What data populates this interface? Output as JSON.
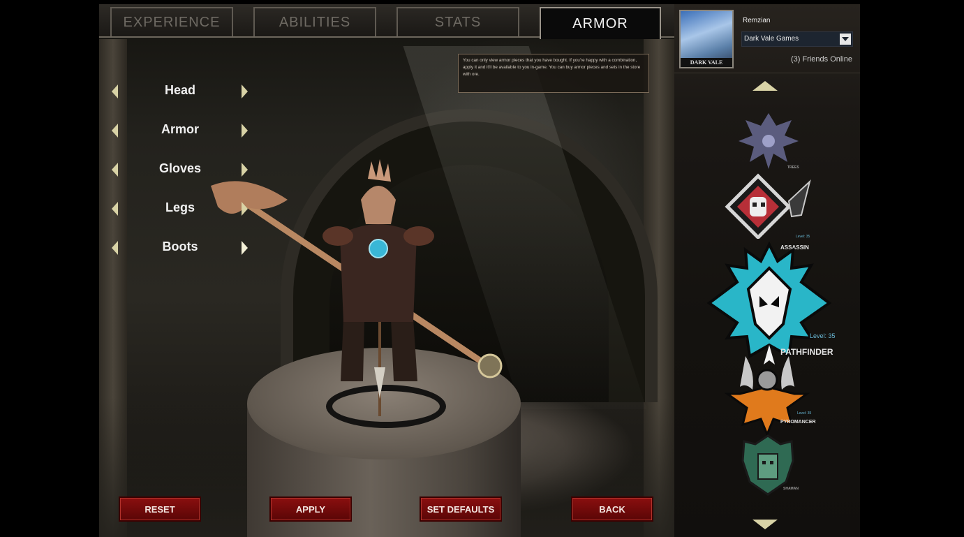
{
  "tabs": [
    {
      "label": "EXPERIENCE",
      "active": false
    },
    {
      "label": "ABILITIES",
      "active": false
    },
    {
      "label": "STATS",
      "active": false
    },
    {
      "label": "ARMOR",
      "active": true
    }
  ],
  "armor_slots": [
    {
      "label": "Head"
    },
    {
      "label": "Armor"
    },
    {
      "label": "Gloves"
    },
    {
      "label": "Legs"
    },
    {
      "label": "Boots"
    }
  ],
  "info_text": "You can only view armor pieces that you have bought. If you're happy with a combination, apply it and it'll be available to you in-game. You can buy armor pieces and sets in the store with ore.",
  "buttons": {
    "reset": "RESET",
    "apply": "APPLY",
    "set_defaults": "SET DEFAULTS",
    "back": "BACK"
  },
  "profile": {
    "username": "Remzian",
    "company": "Dark Vale Games",
    "avatar_caption": "DARK VALE",
    "friends_online": "(3) Friends Online"
  },
  "classes": [
    {
      "name": "TREES",
      "level": "",
      "color": "#7a7ca8",
      "selected": false
    },
    {
      "name": "ASSASSIN",
      "level": "Level: 35",
      "color": "#c0303a",
      "selected": false
    },
    {
      "name": "PATHFINDER",
      "level": "Level: 35",
      "color": "#29b6c8",
      "selected": true
    },
    {
      "name": "PYROMANCER",
      "level": "Level: 35",
      "color": "#e07a1c",
      "selected": false
    },
    {
      "name": "SHAMAN",
      "level": "",
      "color": "#3b8a68",
      "selected": false
    }
  ],
  "icons": {
    "slot_prev": "chevron-left-icon",
    "slot_next": "chevron-right-icon",
    "scroll_up": "triangle-up-icon",
    "scroll_down": "triangle-down-icon",
    "dropdown": "chevron-down-icon"
  }
}
